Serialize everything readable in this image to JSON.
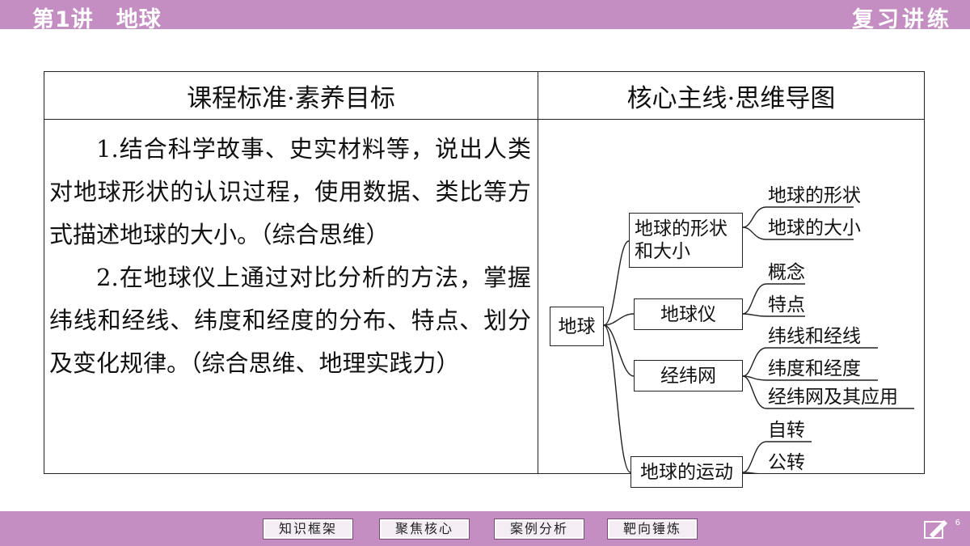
{
  "header": {
    "lecture": "第1讲　地球",
    "section": "复习讲练"
  },
  "table": {
    "col1_header": "课程标准·素养目标",
    "col2_header": "核心主线·思维导图",
    "goals": [
      "1.结合科学故事、史实材料等，说出人类对地球形状的认识过程，使用数据、类比等方式描述地球的大小。（综合思维）",
      "2.在地球仪上通过对比分析的方法，掌握纬线和经线、纬度和经度的分布、特点、划分及变化规律。（综合思维、地理实践力）"
    ]
  },
  "mindmap": {
    "root": "地球",
    "branches": [
      {
        "label_line1": "地球的形状",
        "label_line2": "和大小",
        "children": [
          "地球的形状",
          "地球的大小"
        ]
      },
      {
        "label_line1": "地球仪",
        "children": [
          "概念",
          "特点"
        ]
      },
      {
        "label_line1": "经纬网",
        "children": [
          "纬线和经线",
          "纬度和经度",
          "经纬网及其应用"
        ]
      },
      {
        "label_line1": "地球的运动",
        "children": [
          "自转",
          "公转"
        ]
      }
    ]
  },
  "nav": {
    "items": [
      "知识框架",
      "聚焦核心",
      "案例分析",
      "靶向锤炼"
    ],
    "page": "6"
  },
  "colors": {
    "bar": "#c48ec2"
  }
}
